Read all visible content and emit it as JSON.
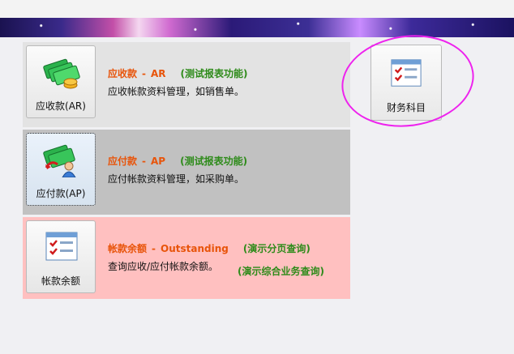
{
  "modules": [
    {
      "label": "应收款(AR)",
      "title_main": "应收款",
      "dash": "-",
      "title_en": "AR",
      "tag": "(测试报表功能)",
      "desc": "应收帐款资料管理，如销售单。"
    },
    {
      "label": "应付款(AP)",
      "title_main": "应付款",
      "dash": "-",
      "title_en": "AP",
      "tag": "(测试报表功能)",
      "desc": "应付帐款资料管理，如采购单。"
    },
    {
      "label": "帐款余额",
      "title_main": "帐款余额",
      "dash": "-",
      "title_en": "Outstanding",
      "tag": "(演示分页查询)",
      "tag2": "(演示综合业务查询)",
      "desc": "查询应收/应付帐款余额。"
    }
  ],
  "side_button": {
    "label": "财务科目"
  },
  "colors": {
    "title": "#e8540a",
    "tag": "#2e8b1a",
    "annotation": "#ee22ee",
    "selected_panel": "#c1c1c1",
    "outstanding_panel": "#ffc0c0"
  },
  "icons": {
    "ar": "money-icon",
    "ap": "money-user-icon",
    "outstanding": "checklist-icon",
    "side": "checklist-icon"
  }
}
